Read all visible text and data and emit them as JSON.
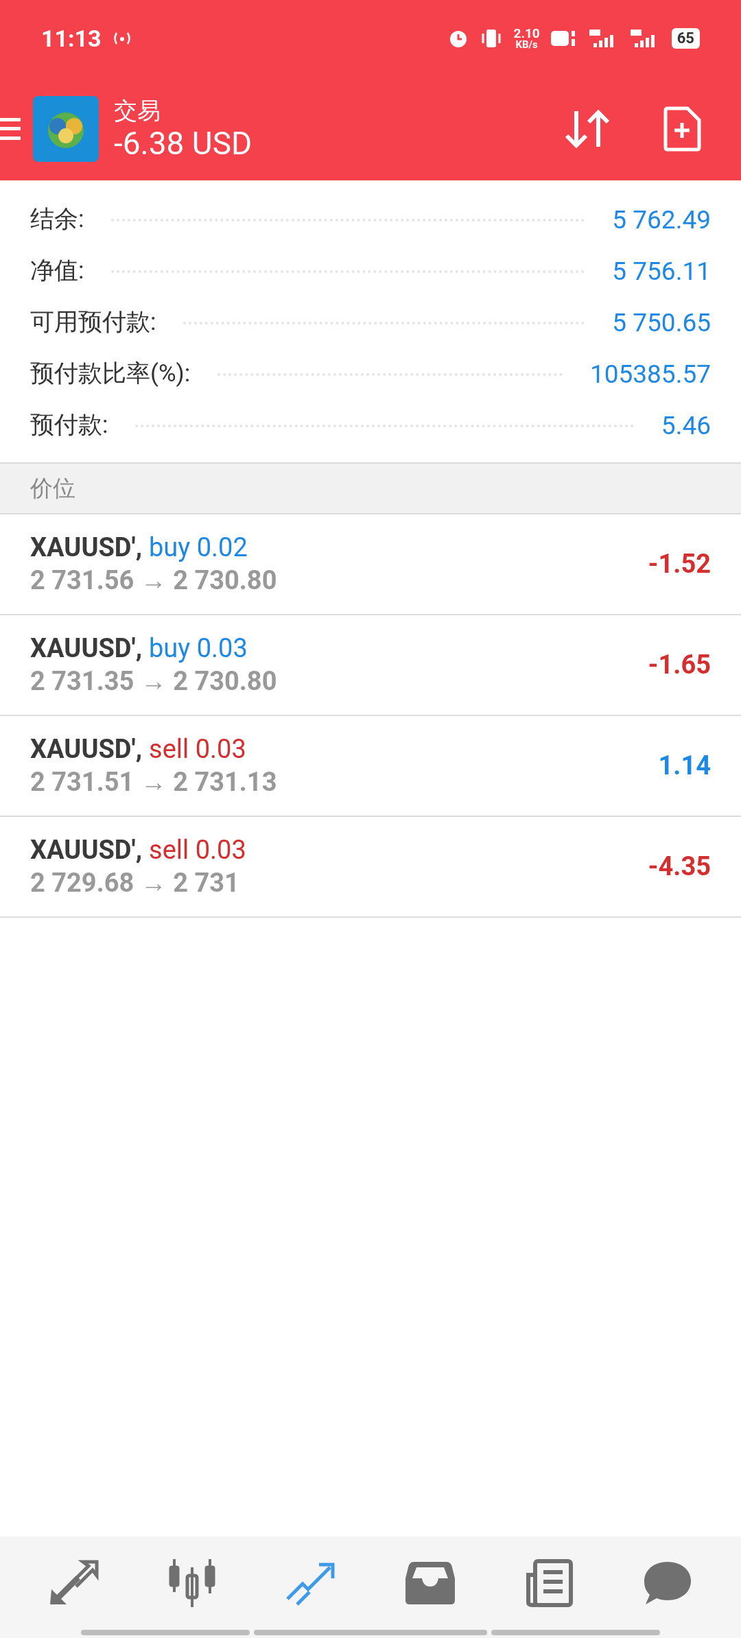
{
  "status_bar": {
    "time": "11:13",
    "speed": "2.10",
    "speed_unit": "KB/s",
    "battery": "65"
  },
  "header": {
    "title": "交易",
    "profit": "-6.38 USD"
  },
  "summary": [
    {
      "label": "结余:",
      "value": "5 762.49"
    },
    {
      "label": "净值:",
      "value": "5 756.11"
    },
    {
      "label": "可用预付款:",
      "value": "5 750.65"
    },
    {
      "label": "预付款比率(%):",
      "value": "105385.57"
    },
    {
      "label": "预付款:",
      "value": "5.46"
    }
  ],
  "section_title": "价位",
  "positions": [
    {
      "symbol": "XAUUSD',",
      "kind": "long",
      "order": "buy 0.02",
      "prices": "2 731.56 → 2 730.80",
      "profit": "-1.52",
      "positive": false
    },
    {
      "symbol": "XAUUSD',",
      "kind": "long",
      "order": "buy 0.03",
      "prices": "2 731.35 → 2 730.80",
      "profit": "-1.65",
      "positive": false
    },
    {
      "symbol": "XAUUSD',",
      "kind": "short",
      "order": "sell 0.03",
      "prices": "2 731.51 → 2 731.13",
      "profit": "1.14",
      "positive": true
    },
    {
      "symbol": "XAUUSD',",
      "kind": "short",
      "order": "sell 0.03",
      "prices": "2 729.68 → 2 731",
      "profit": "-4.35",
      "positive": false
    }
  ],
  "nav": [
    {
      "kind": "quotes",
      "selected": false
    },
    {
      "kind": "chart",
      "selected": false
    },
    {
      "kind": "trade",
      "selected": true
    },
    {
      "kind": "history",
      "selected": false
    },
    {
      "kind": "news",
      "selected": false
    },
    {
      "kind": "chat",
      "selected": false
    }
  ]
}
